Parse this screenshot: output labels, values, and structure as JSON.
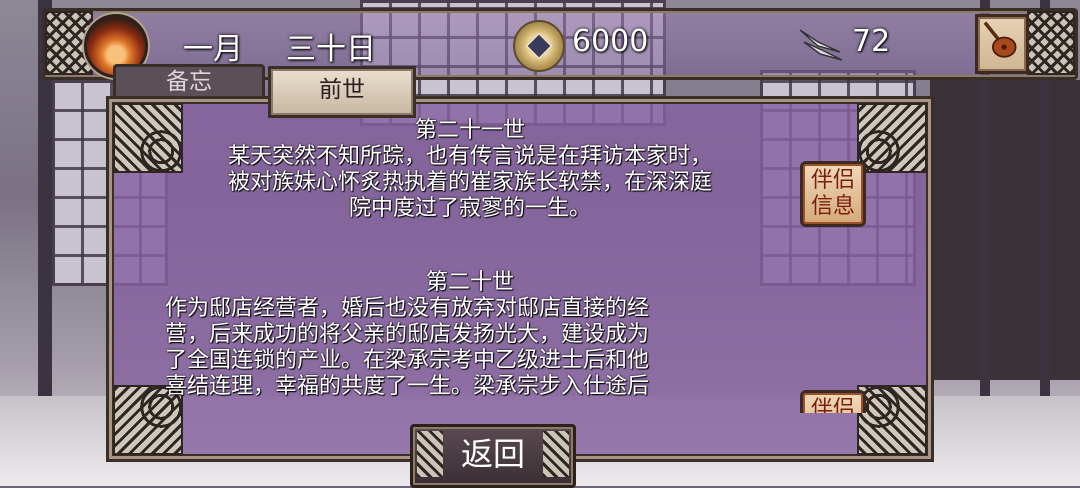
{
  "hud": {
    "month": "一月",
    "day": "三十日",
    "coins": "6000",
    "fish": "72"
  },
  "tabs": [
    {
      "label": "备忘",
      "active": false
    },
    {
      "label": "前世",
      "active": true
    }
  ],
  "lives": [
    {
      "title": "第二十一世",
      "lines": [
        "某天突然不知所踪，也有传言说是在拜访本家时，",
        "被对族妹心怀炙热执着的崔家族长软禁，在深深庭",
        "院中度过了寂寥的一生。"
      ],
      "partner_button": "伴侣信息"
    },
    {
      "title": "第二十世",
      "lines": [
        "作为邸店经营者，婚后也没有放弃对邸店直接的经",
        "营，后来成功的将父亲的邸店发扬光大，建设成为",
        "了全国连锁的产业。在梁承宗考中乙级进士后和他",
        "喜结连理，幸福的共度了一生。梁承宗步入仕途后"
      ],
      "partner_button": "伴侣信息"
    }
  ],
  "back_button": "返回",
  "icons": {
    "sun": "sunset-emblem-icon",
    "coin": "coin-icon",
    "fish": "fish-icon",
    "lute": "lute-icon"
  },
  "colors": {
    "panel": "#8661a0",
    "button_text": "#7a1e10"
  }
}
